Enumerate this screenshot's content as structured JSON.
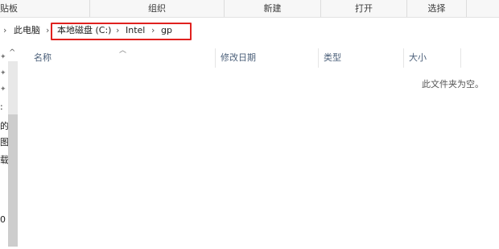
{
  "ribbon": {
    "groups": [
      "贴板",
      "组织",
      "新建",
      "打开",
      "选择"
    ]
  },
  "address": {
    "root_crumb": "此电脑",
    "crumbs": [
      "本地磁盘 (C:)",
      "Intel",
      "gp"
    ]
  },
  "nav_pane": {
    "truncated_items": [
      ":",
      "的",
      "图",
      "载",
      "0"
    ]
  },
  "columns": [
    "名称",
    "修改日期",
    "类型",
    "大小"
  ],
  "empty_message": "此文件夹为空。"
}
